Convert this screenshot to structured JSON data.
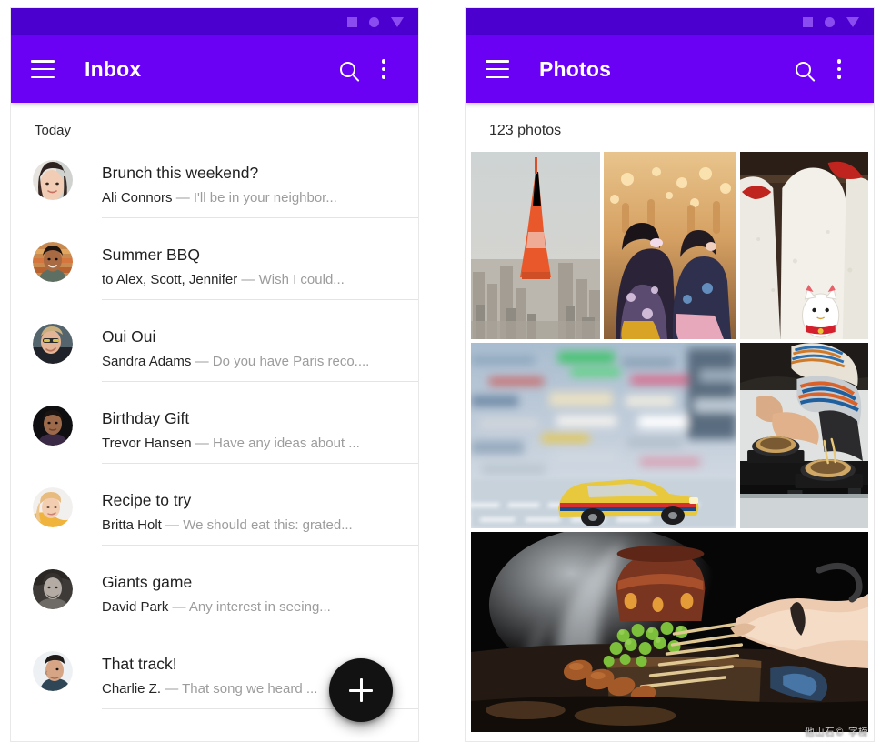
{
  "status_bar": {
    "icons": [
      "square-icon",
      "circle-icon",
      "triangle-down-icon"
    ],
    "color": "#4c00d0"
  },
  "theme": {
    "app_bar_color": "#6a00f4",
    "status_bar_color": "#4c00d0",
    "fab_color": "#121212",
    "divider_color": "#e4e4e4",
    "primary_text": "#1f1f1f",
    "secondary_text": "#9c9c9c"
  },
  "inbox": {
    "app_bar": {
      "menu_label": "menu",
      "title": "Inbox",
      "search_label": "search",
      "overflow_label": "more options"
    },
    "section_label": "Today",
    "fab_label": "+",
    "messages": [
      {
        "subject": "Brunch this weekend?",
        "sender": "Ali Connors",
        "dash": "—",
        "snippet": "I'll be in your neighbor...",
        "avatar": "avatar-ali-connors"
      },
      {
        "subject": "Summer BBQ",
        "sender": "to Alex, Scott, Jennifer",
        "dash": "—",
        "snippet": "Wish I could...",
        "avatar": "avatar-summer-bbq"
      },
      {
        "subject": "Oui Oui",
        "sender": "Sandra Adams",
        "dash": "—",
        "snippet": "Do you have Paris reco....",
        "avatar": "avatar-sandra-adams"
      },
      {
        "subject": "Birthday Gift",
        "sender": "Trevor Hansen",
        "dash": "—",
        "snippet": "Have any ideas about ...",
        "avatar": "avatar-trevor-hansen"
      },
      {
        "subject": "Recipe to try",
        "sender": "Britta Holt",
        "dash": "—",
        "snippet": "We should eat this: grated...",
        "avatar": "avatar-britta-holt"
      },
      {
        "subject": "Giants game",
        "sender": "David Park",
        "dash": "—",
        "snippet": "Any interest in seeing...",
        "avatar": "avatar-david-park"
      },
      {
        "subject": "That track!",
        "sender": "Charlie Z.",
        "dash": "—",
        "snippet": "That song we heard ...",
        "avatar": "avatar-charlie-z"
      }
    ]
  },
  "photos": {
    "app_bar": {
      "menu_label": "menu",
      "title": "Photos",
      "search_label": "search",
      "overflow_label": "more options"
    },
    "count_label": "123 photos",
    "watermark": "他山石© 字榜",
    "grid": [
      [
        {
          "name": "photo-tokyo-tower",
          "alt": "Tokyo Tower over city skyline"
        },
        {
          "name": "photo-kimono-crowd",
          "alt": "Women in kimono at festival"
        },
        {
          "name": "photo-lucky-cats",
          "alt": "Stone cat statues with red bibs"
        }
      ],
      [
        {
          "name": "photo-taxi-motion-blur",
          "alt": "Yellow taxi in blurred city street"
        },
        {
          "name": "photo-noodle-bowls",
          "alt": "Person eating noodles at a table"
        }
      ],
      [
        {
          "name": "photo-yakitori-grill",
          "alt": "Hands grilling skewers over fire"
        }
      ]
    ]
  }
}
